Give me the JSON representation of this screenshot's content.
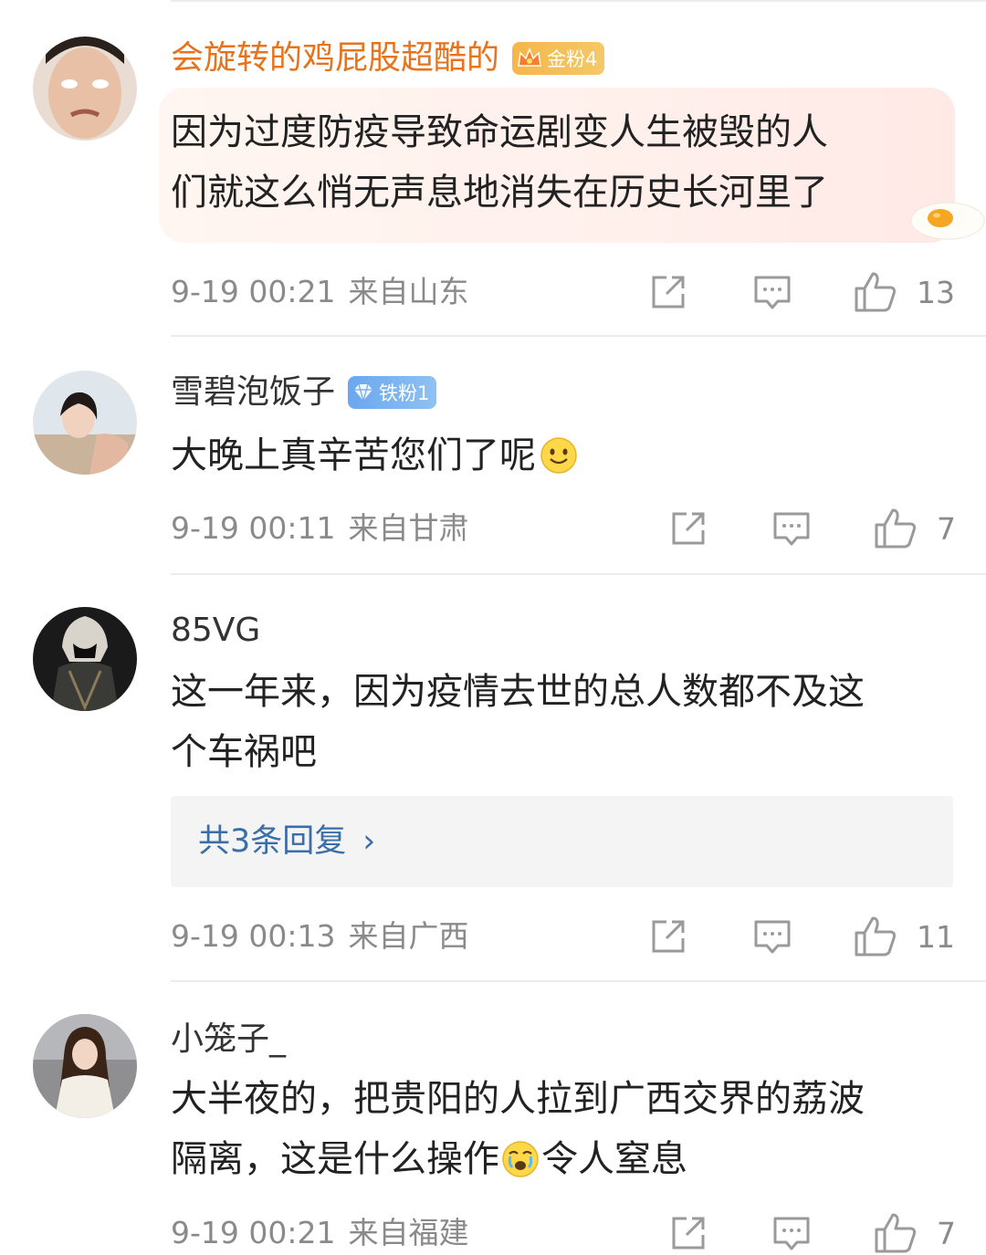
{
  "comments": [
    {
      "author": "会旋转的鸡屁股超酷的",
      "badge": "金粉4",
      "text_lines": [
        "因为过度防疫导致命运剧变人生被毁的人",
        "们就这么悄无声息地消失在历史长河里了"
      ],
      "time": "9-19 00:21",
      "source": "来自山东",
      "likes": "13"
    },
    {
      "author": "雪碧泡饭子",
      "badge": "铁粉1",
      "text_lines": [
        "大晚上真辛苦您们了呢"
      ],
      "emoji": "smile-emoji",
      "time": "9-19 00:11",
      "source": "来自甘肃",
      "likes": "7"
    },
    {
      "author": "85VG",
      "text_lines": [
        "这一年来，因为疫情去世的总人数都不及这",
        "个车祸吧"
      ],
      "replies_label": "共3条回复",
      "replies_chevron": "›",
      "time": "9-19 00:13",
      "source": "来自广西",
      "likes": "11"
    },
    {
      "author": "小笼子_",
      "text_lines_1": "大半夜的，把贵阳的人拉到广西交界的荔波",
      "text_line_2a": "隔离，这是什么操作",
      "text_line_2b": "令人窒息",
      "emoji": "cry-emoji",
      "time": "9-19 00:21",
      "source": "来自福建",
      "likes": "7"
    }
  ],
  "colors": {
    "gold_name": "#e8731d",
    "meta_gray": "#8a8a8a",
    "link_blue": "#3a6ea8",
    "icon_gray": "#9a9a9a"
  },
  "icons": [
    "share-icon",
    "comment-icon",
    "like-icon"
  ]
}
